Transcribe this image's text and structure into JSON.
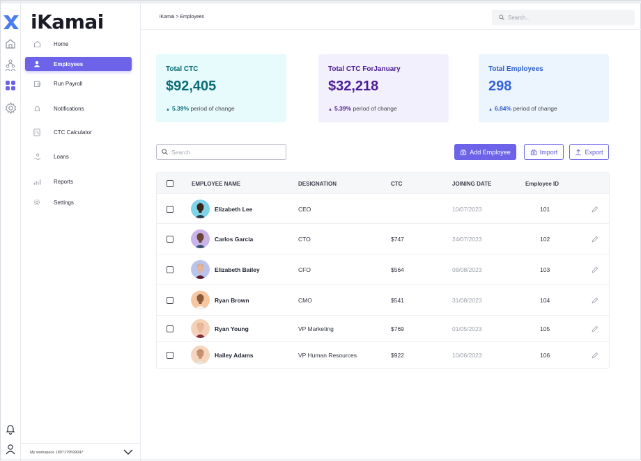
{
  "app": {
    "brand": "iKamai",
    "workspace_label": "My workspace 1897179599047"
  },
  "sidebar": {
    "items": [
      {
        "label": "Home",
        "icon": "home-icon"
      },
      {
        "label": "Employees",
        "icon": "user-icon",
        "active": true
      },
      {
        "label": "Run Payroll",
        "icon": "wallet-icon"
      },
      {
        "label": "Notifications",
        "icon": "bell-icon"
      },
      {
        "label": "CTC Calculator",
        "icon": "calculator-icon"
      },
      {
        "label": "Loans",
        "icon": "loan-icon"
      },
      {
        "label": "Reports",
        "icon": "bar-chart-icon"
      },
      {
        "label": "Settings",
        "icon": "gear-icon"
      }
    ]
  },
  "header": {
    "breadcrumb": "iKamai > Employees",
    "search_placeholder": "Search..."
  },
  "cards": [
    {
      "title": "Total CTC",
      "value": "$92,405",
      "change_pct": "5.39%",
      "change_text": "period of change",
      "title_color": "#0b6b74",
      "value_color": "#0b6b74",
      "pct_color": "#0b6b74",
      "bg": "#e7fbfd"
    },
    {
      "title": "Total CTC ForJanuary",
      "value": "$32,218",
      "change_pct": "5.39%",
      "change_text": "period of change",
      "title_color": "#4b1e95",
      "value_color": "#4b1e95",
      "pct_color": "#4b1e95",
      "bg": "#f3f0fd"
    },
    {
      "title": "Total Employees",
      "value": "298",
      "change_pct": "6.84%",
      "change_text": "period of change",
      "title_color": "#2f5ec9",
      "value_color": "#3463d8",
      "pct_color": "#2f5ec9",
      "bg": "#ecf4fd"
    }
  ],
  "toolbar": {
    "search_placeholder": "Search",
    "add_label": "Add Employee",
    "import_label": "Import",
    "export_label": "Export"
  },
  "table": {
    "columns": [
      "EMPLOYEE NAME",
      "DESIGNATION",
      "CTC",
      "JOINING DATE",
      "Employee ID"
    ],
    "rows": [
      {
        "name": "Elizabeth Lee",
        "designation": "CEO",
        "ctc": "",
        "joining_date": "10/07/2023",
        "employee_id": "101",
        "avatar_bg": "#7fd3e6",
        "skin": "#3b2418",
        "hair": "#1a1210",
        "shirt": "#2e3a4a"
      },
      {
        "name": "Carlos Garcia",
        "designation": "CTO",
        "ctc": "$747",
        "joining_date": "24/07/2023",
        "employee_id": "102",
        "avatar_bg": "#c9b3e9",
        "skin": "#6a4632",
        "hair": "#1f1714",
        "shirt": "#3a4f6e"
      },
      {
        "name": "Elizabeth Bailey",
        "designation": "CFO",
        "ctc": "$564",
        "joining_date": "08/08/2023",
        "employee_id": "103",
        "avatar_bg": "#b9c4ec",
        "skin": "#e6b49a",
        "hair": "#3a2118",
        "shirt": "#5c1a2e"
      },
      {
        "name": "Ryan Brown",
        "designation": "CMO",
        "ctc": "$541",
        "joining_date": "31/08/2023",
        "employee_id": "104",
        "avatar_bg": "#f6c6a0",
        "skin": "#8a5a3c",
        "hair": "#2a1a12",
        "shirt": "#f2f2f2"
      },
      {
        "name": "Ryan Young",
        "designation": "VP Marketing",
        "ctc": "$769",
        "joining_date": "01/05/2023",
        "employee_id": "105",
        "avatar_bg": "#f5d0b8",
        "skin": "#e9b89a",
        "hair": "#4a2418",
        "shirt": "#8a2c3a"
      },
      {
        "name": "Hailey Adams",
        "designation": "VP Human Resources",
        "ctc": "$922",
        "joining_date": "10/06/2023",
        "employee_id": "106",
        "avatar_bg": "#f3d6bd",
        "skin": "#c89070",
        "hair": "#3b2418",
        "shirt": "#e8e6e2"
      }
    ]
  },
  "colors": {
    "accent": "#6c63e8",
    "brand_mark": "#4a7df0"
  }
}
